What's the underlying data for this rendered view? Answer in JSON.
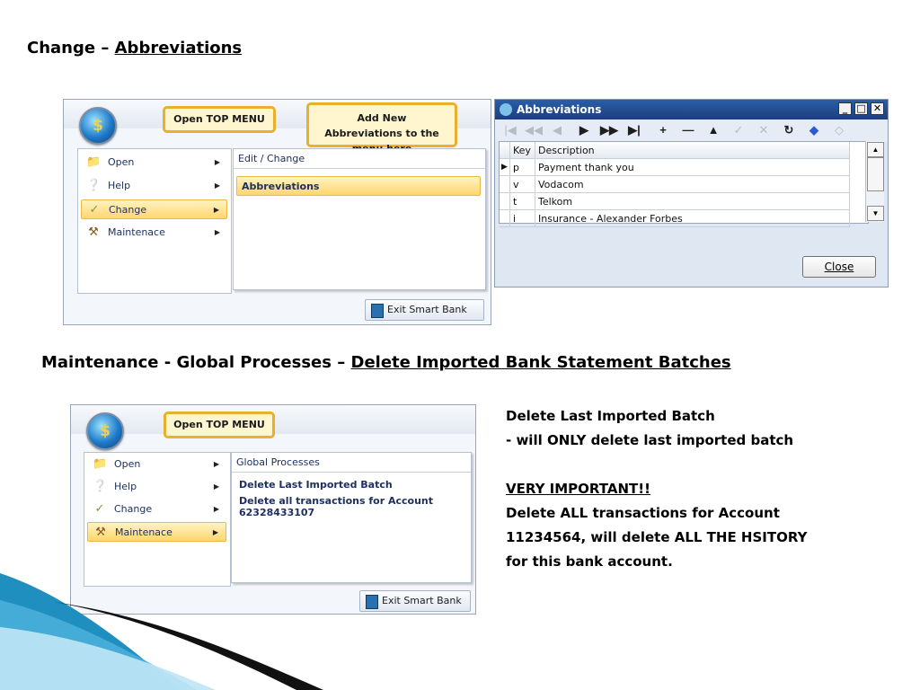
{
  "section1": {
    "heading_prefix": "Change – ",
    "heading_link": "Abbreviations"
  },
  "screen1": {
    "callout_top": "Open TOP MENU",
    "callout_add": "Add New Abbreviations to the menu here",
    "menu": [
      "Open",
      "Help",
      "Change",
      "Maintenace"
    ],
    "active_index": 2,
    "submenu_title": "Edit / Change",
    "submenu_items": [
      "Abbreviations"
    ],
    "exit_label": "Exit Smart Bank"
  },
  "abbrev_window": {
    "title": "Abbreviations",
    "col_key": "Key",
    "col_desc": "Description",
    "rows": [
      {
        "key": "p",
        "desc": "Payment thank you"
      },
      {
        "key": "v",
        "desc": "Vodacom"
      },
      {
        "key": "t",
        "desc": "Telkom"
      },
      {
        "key": "i",
        "desc": "Insurance - Alexander Forbes"
      }
    ],
    "close_label": "Close"
  },
  "section2": {
    "heading_prefix": "Maintenance - Global Processes – ",
    "heading_link": "Delete Imported Bank Statement Batches"
  },
  "screen2": {
    "callout_top": "Open TOP MENU",
    "menu": [
      "Open",
      "Help",
      "Change",
      "Maintenace"
    ],
    "active_index": 3,
    "submenu_title": "Global Processes",
    "item1": "Delete Last Imported Batch",
    "item2_line1": "Delete all transactions for Account",
    "item2_line2": "62328433107",
    "exit_label": "Exit Smart Bank"
  },
  "notes": {
    "line1": "Delete Last Imported Batch",
    "line2": "- will ONLY delete last imported batch",
    "important": "VERY IMPORTANT!!",
    "line3": "Delete ALL transactions for Account",
    "line4": "11234564, will delete ALL THE HSITORY",
    "line5": "for this bank account."
  },
  "icons": [
    "folder-icon",
    "help-icon",
    "change-icon",
    "hammer-icon",
    "door-icon",
    "app-orb-icon"
  ],
  "colors": {
    "highlight": "#ffd66e",
    "callout_border": "#e8b02c",
    "window_title": "#1c3f7c",
    "decor_blue": "#1f8fc0"
  }
}
